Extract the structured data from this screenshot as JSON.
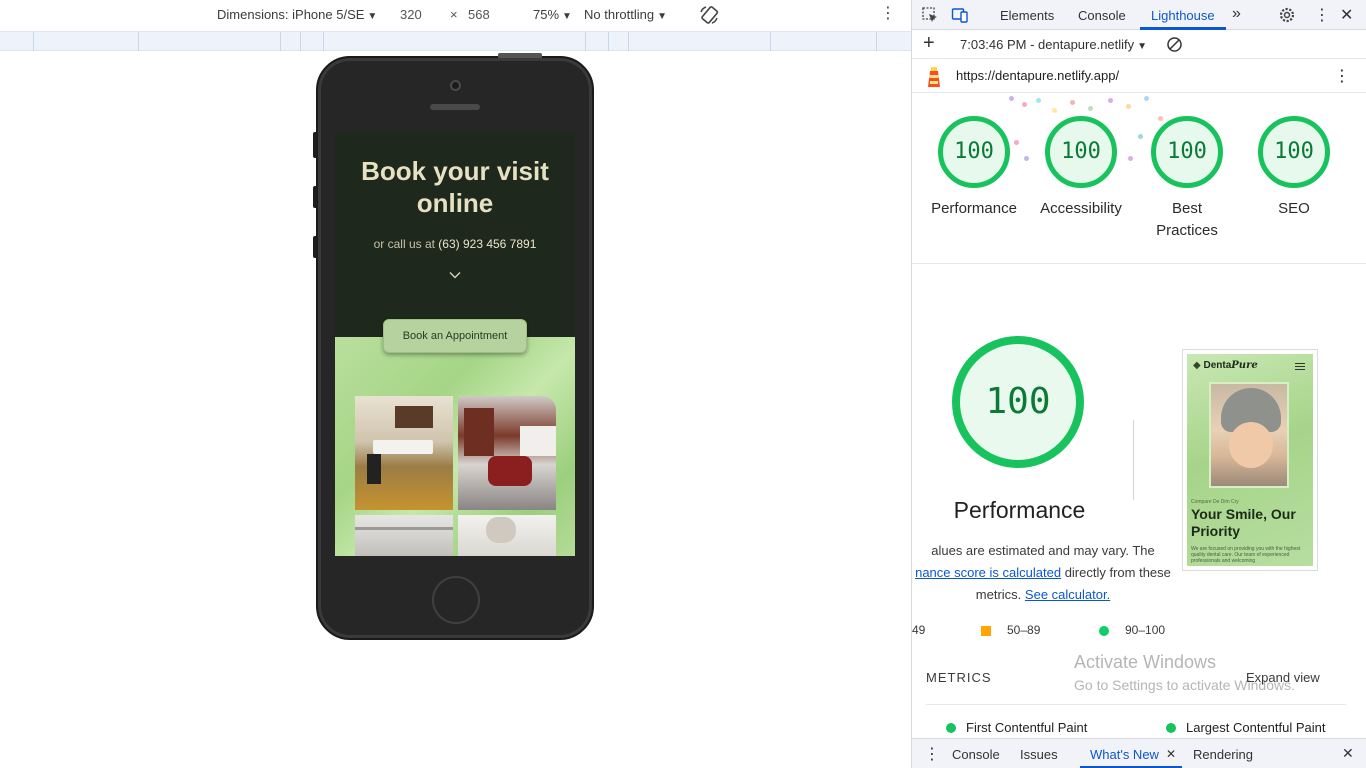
{
  "device_toolbar": {
    "dimensions_label": "Dimensions: iPhone 5/SE",
    "width": "320",
    "times": "×",
    "height": "568",
    "zoom": "75%",
    "throttling": "No throttling"
  },
  "emulated_page": {
    "title": "Book your visit online",
    "subtitle_prefix": "or call us at ",
    "phone": "(63) 923 456 7891",
    "cta_label": "Book an Appointment"
  },
  "devtools": {
    "tabs": [
      "Elements",
      "Console",
      "Lighthouse"
    ],
    "active_tab": "Lighthouse",
    "report_time": "7:03:46 PM - dentapure.netlify",
    "url": "https://dentapure.netlify.app/",
    "scores": [
      {
        "label": "Performance",
        "value": "100"
      },
      {
        "label": "Accessibility",
        "value": "100"
      },
      {
        "label": "Best Practices",
        "value": "100"
      },
      {
        "label": "SEO",
        "value": "100"
      }
    ],
    "performance": {
      "score": "100",
      "title": "Performance",
      "note_line1": "alues are estimated and may vary. The",
      "note_link1": "nance score is calculated",
      "note_line2_rest": " directly from these",
      "note_line3_prefix": "metrics. ",
      "note_link2": "See calculator."
    },
    "thumbnail": {
      "logo": "Denta",
      "logo_accent": "Pure",
      "small_text": "Compare De Dim Cry",
      "headline": "Your Smile, Our Priority",
      "body": "We are focused on providing you with the highest quality dental care. Our team of experienced professionals and welcoming"
    },
    "legend": [
      {
        "label": "49"
      },
      {
        "label": "50–89",
        "color": "#ffa400"
      },
      {
        "label": "90–100",
        "color": "#0cce6b"
      }
    ],
    "metrics_header": "METRICS",
    "expand_label": "Expand view",
    "metrics": [
      "First Contentful Paint",
      "Largest Contentful Paint"
    ],
    "watermark_title": "Activate Windows",
    "watermark_sub": "Go to Settings to activate Windows.",
    "drawer_tabs": [
      "Console",
      "Issues",
      "What's New",
      "Rendering"
    ],
    "drawer_active": "What's New"
  }
}
